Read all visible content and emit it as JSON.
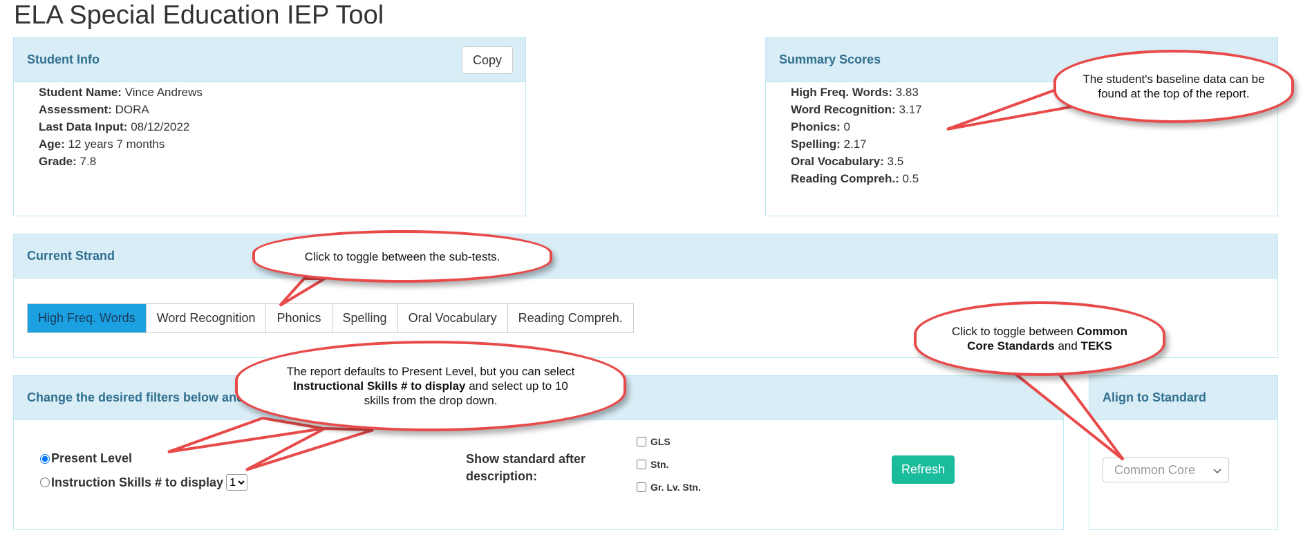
{
  "page": {
    "title": "ELA Special Education IEP Tool"
  },
  "student_info": {
    "heading": "Student Info",
    "copy_label": "Copy",
    "fields": [
      {
        "label": "Student Name:",
        "value": "Vince Andrews"
      },
      {
        "label": "Assessment:",
        "value": "DORA"
      },
      {
        "label": "Last Data Input:",
        "value": "08/12/2022"
      },
      {
        "label": "Age:",
        "value": "12 years 7 months"
      },
      {
        "label": "Grade:",
        "value": "7.8"
      }
    ]
  },
  "summary_scores": {
    "heading": "Summary Scores",
    "scores": [
      {
        "label": "High Freq. Words:",
        "value": "3.83"
      },
      {
        "label": "Word Recognition:",
        "value": "3.17"
      },
      {
        "label": "Phonics:",
        "value": "0"
      },
      {
        "label": "Spelling:",
        "value": "2.17"
      },
      {
        "label": "Oral Vocabulary:",
        "value": "3.5"
      },
      {
        "label": "Reading Compreh.:",
        "value": "0.5"
      }
    ]
  },
  "current_strand": {
    "heading": "Current Strand",
    "tabs": [
      {
        "label": "High Freq. Words",
        "active": true
      },
      {
        "label": "Word Recognition"
      },
      {
        "label": "Phonics"
      },
      {
        "label": "Spelling"
      },
      {
        "label": "Oral Vocabulary"
      },
      {
        "label": "Reading Compreh."
      }
    ]
  },
  "filters": {
    "heading": "Change the desired filters below and",
    "present_level_label": "Present Level",
    "instruction_skills_label": "Instruction Skills # to display",
    "instruction_skills_value": "1",
    "show_standard_label": "Show standard after description:",
    "checkboxes": [
      "GLS",
      "Stn.",
      "Gr. Lv. Stn."
    ],
    "refresh_label": "Refresh"
  },
  "align": {
    "heading": "Align to Standard",
    "selected": "Common Core"
  },
  "callouts": {
    "baseline": "The student's baseline data can be found at the top of the report.",
    "toggle_subtests": "Click to toggle between the sub-tests.",
    "defaults_a": "The report defaults to Present Level, but you can select ",
    "defaults_b": "Instructional Skills # to display",
    "defaults_c": " and select up to 10 skills from the drop down.",
    "standards_a": "Click to toggle between ",
    "standards_b": "Common Core Standards",
    "standards_c": " and ",
    "standards_d": "TEKS"
  },
  "colors": {
    "panel_heading_bg": "#d9edf7",
    "panel_heading_text": "#31708f",
    "active_tab": "#1ba1e2",
    "refresh_button": "#1abc9c",
    "callout_border": "#e84a4a"
  }
}
